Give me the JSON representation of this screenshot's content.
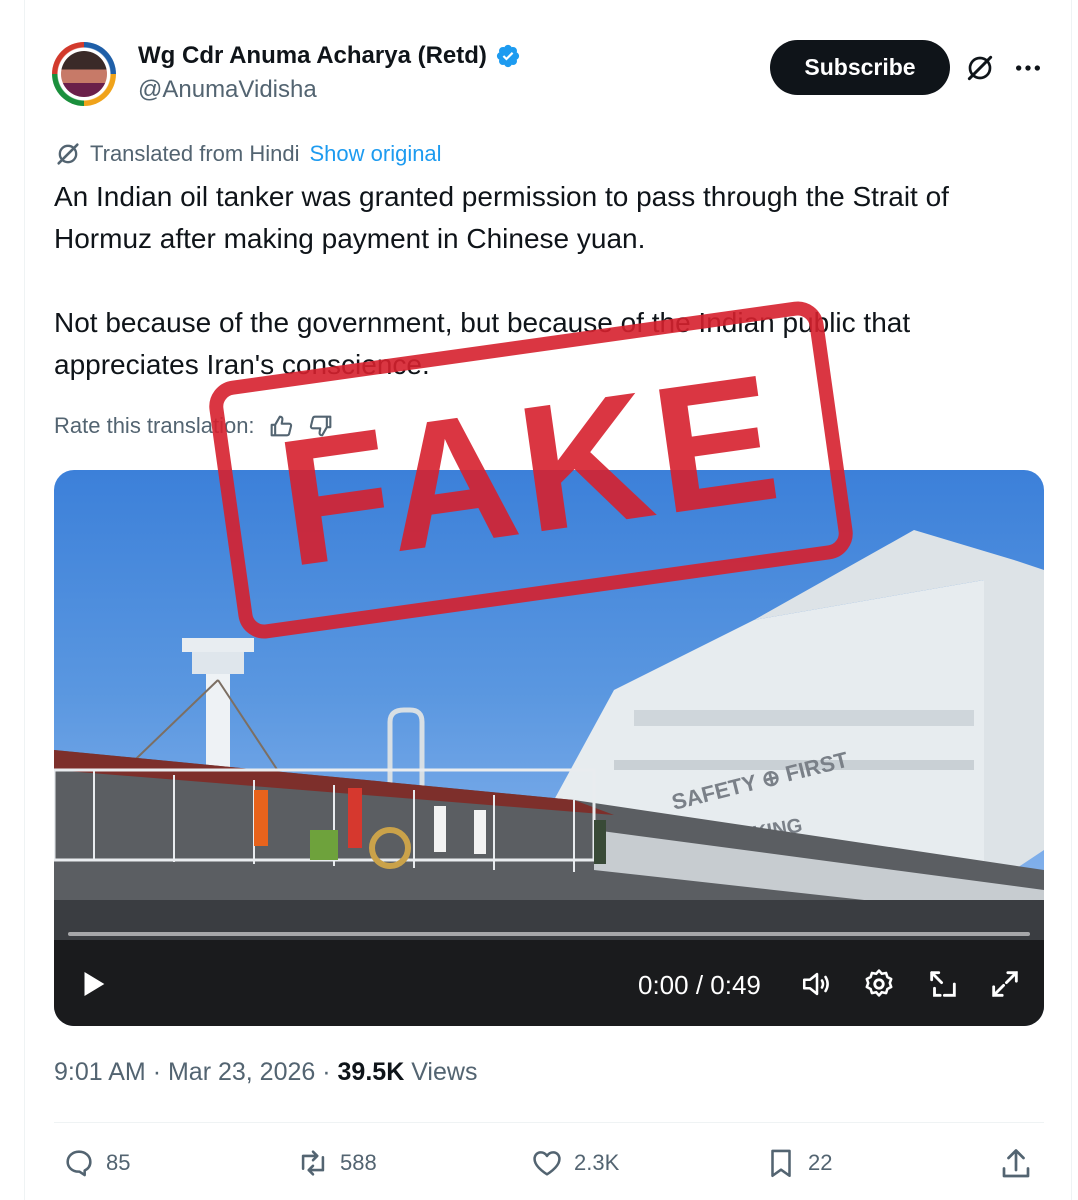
{
  "author": {
    "name": "Wg Cdr Anuma Acharya (Retd)",
    "handle": "@AnumaVidisha",
    "avatar_icon": "profile-avatar",
    "verified_icon": "verified-badge-icon",
    "verified_color": "#1d9bf0"
  },
  "header": {
    "subscribe_label": "Subscribe",
    "grok_icon": "grok-icon",
    "more_icon": "more-icon"
  },
  "translation": {
    "translated_label": "Translated from Hindi",
    "show_original_label": "Show original",
    "rate_label": "Rate this translation:"
  },
  "tweet": {
    "paragraph_1": "An Indian oil tanker was granted permission to pass through the Strait of Hormuz after making payment in Chinese yuan.",
    "paragraph_2": "Not because of the government, but because of the Indian public that appreciates Iran's conscience."
  },
  "stamp": {
    "text": "FAKE",
    "color": "#d6202d"
  },
  "video": {
    "time": "0:00 / 0:49",
    "progress": 0,
    "ship_text": "SAFETY ⊕ FIRST",
    "ship_text_2": "KING"
  },
  "meta": {
    "time": "9:01 AM",
    "separator": "·",
    "date": "Mar 23, 2026",
    "views_count": "39.5K",
    "views_label": "Views"
  },
  "actions": {
    "replies": "85",
    "reposts": "588",
    "likes": "2.3K",
    "bookmarks": "22"
  },
  "colors": {
    "accent": "#1d9bf0",
    "text_primary": "#0f1419",
    "text_secondary": "#536471"
  }
}
